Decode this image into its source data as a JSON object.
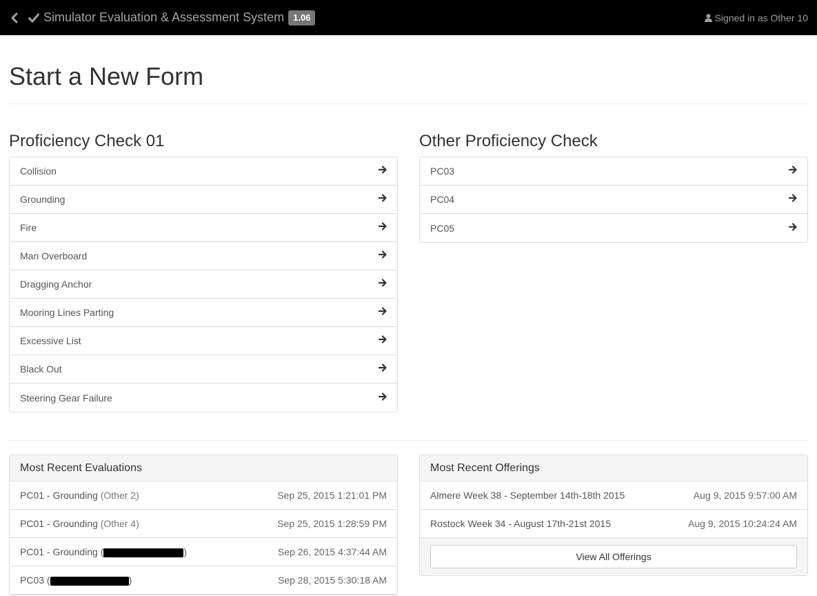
{
  "navbar": {
    "back_icon": "chevron-left-icon",
    "brand_icon": "check-icon",
    "title": "Simulator Evaluation & Assessment System",
    "version": "1.06",
    "user_icon": "user-icon",
    "signed_in": "Signed in as Other 10"
  },
  "page": {
    "title": "Start a New Form"
  },
  "pc01": {
    "title": "Proficiency Check 01",
    "items": [
      {
        "label": "Collision"
      },
      {
        "label": "Grounding"
      },
      {
        "label": "Fire"
      },
      {
        "label": "Man Overboard"
      },
      {
        "label": "Dragging Anchor"
      },
      {
        "label": "Mooring Lines Parting"
      },
      {
        "label": "Excessive List"
      },
      {
        "label": "Black Out"
      },
      {
        "label": "Steering Gear Failure"
      }
    ]
  },
  "other_pc": {
    "title": "Other Proficiency Check",
    "items": [
      {
        "label": "PC03"
      },
      {
        "label": "PC04"
      },
      {
        "label": "PC05"
      }
    ]
  },
  "recent_evaluations": {
    "title": "Most Recent Evaluations",
    "rows": [
      {
        "form": "PC01 - Grounding",
        "open": " (",
        "who": "Other 2",
        "close": ")",
        "when": "Sep 25, 2015 1:21:01 PM"
      },
      {
        "form": "PC01 - Grounding",
        "open": " (",
        "who": "Other 4",
        "close": ")",
        "when": "Sep 25, 2015 1:28:59 PM"
      },
      {
        "form": "PC01 - Grounding",
        "open": " (",
        "who": "",
        "close": ")",
        "when": "Sep 26, 2015 4:37:44 AM"
      },
      {
        "form": "PC03",
        "open": " (",
        "who": "",
        "close": ")",
        "when": "Sep 28, 2015 5:30:18 AM"
      }
    ]
  },
  "recent_offerings": {
    "title": "Most Recent Offerings",
    "rows": [
      {
        "name": "Almere Week 38 - September 14th-18th 2015",
        "when": "Aug 9, 2015 9:57:00 AM"
      },
      {
        "name": "Rostock Week 34 - August 17th-21st 2015",
        "when": "Aug 9, 2015 10:24:24 AM"
      }
    ],
    "view_all": "View All Offerings"
  },
  "colors": {
    "navbar_bg": "#000000",
    "badge_bg": "#777777",
    "panel_heading_bg": "#f5f5f5",
    "border": "#dddddd"
  }
}
